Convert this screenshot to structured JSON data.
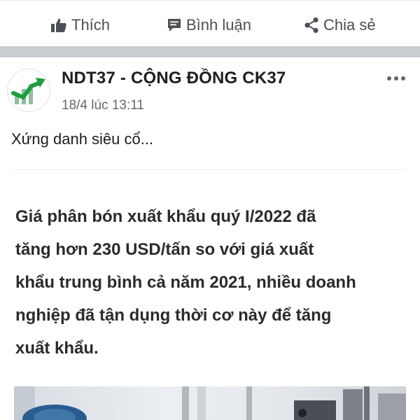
{
  "actions": {
    "like_label": "Thích",
    "comment_label": "Bình luận",
    "share_label": "Chia sẻ"
  },
  "post": {
    "author": "NDT37 - CỘNG ĐỒNG CK37",
    "timestamp": "18/4 lúc 13:11",
    "caption": "Xứng danh siêu cổ...",
    "article_lines": [
      "Giá phân bón xuất khẩu quý I/2022 đã",
      "tăng hơn 230 USD/tấn so với giá xuất",
      "khẩu trung bình cả năm 2021, nhiều doanh",
      "nghiệp đã tận dụng thời cơ này để tăng",
      "xuất khẩu."
    ]
  },
  "colors": {
    "action_text": "#4b4f56",
    "separator_band": "#c9ccd1",
    "avatar_arrow": "#1e9e3c"
  },
  "icons": {
    "like": "thumbs-up-icon",
    "comment": "comment-bubble-icon",
    "share": "share-icon",
    "more": "more-horizontal-icon"
  }
}
